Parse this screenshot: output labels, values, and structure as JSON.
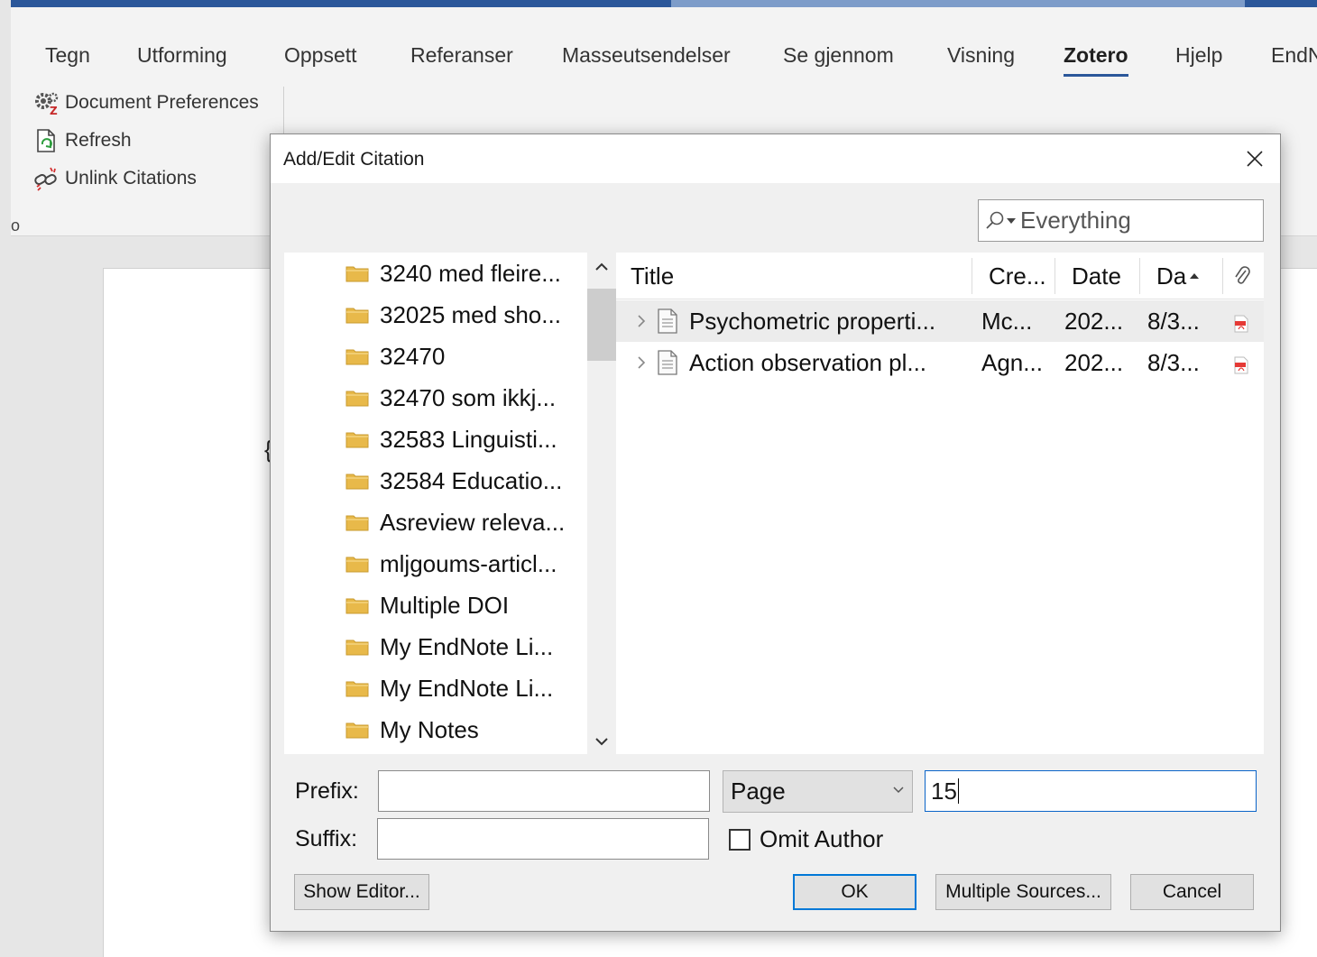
{
  "ribbon": {
    "tabs": [
      {
        "label": "Tegn"
      },
      {
        "label": "Utforming"
      },
      {
        "label": "Oppsett"
      },
      {
        "label": "Referanser"
      },
      {
        "label": "Masseutsendelser"
      },
      {
        "label": "Se gjennom"
      },
      {
        "label": "Visning"
      },
      {
        "label": "Zotero",
        "active": true
      },
      {
        "label": "Hjelp"
      },
      {
        "label": "EndN"
      }
    ],
    "commands": {
      "document_preferences": "Document Preferences",
      "refresh": "Refresh",
      "unlink_citations": "Unlink Citations"
    },
    "group_label": "o"
  },
  "document": {
    "visible_text": "{"
  },
  "dialog": {
    "title": "Add/Edit Citation",
    "search": {
      "mode_value": "Everything"
    },
    "collections": [
      "3240 med fleire...",
      "32025 med sho...",
      "32470",
      "32470 som ikkj...",
      "32583 Linguisti...",
      "32584 Educatio...",
      "Asreview releva...",
      "mljgoums-articl...",
      "Multiple DOI",
      "My EndNote Li...",
      "My EndNote Li...",
      "My Notes"
    ],
    "items_columns": {
      "title": "Title",
      "creator": "Cre...",
      "date": "Date",
      "date_added": "Da"
    },
    "items": [
      {
        "title": "Psychometric properti...",
        "creator": "Mc...",
        "date": "202...",
        "date_added": "8/3..."
      },
      {
        "title": "Action observation pl...",
        "creator": "Agn...",
        "date": "202...",
        "date_added": "8/3..."
      }
    ],
    "form": {
      "prefix_label": "Prefix:",
      "prefix_value": "",
      "suffix_label": "Suffix:",
      "suffix_value": "",
      "locator_type": "Page",
      "locator_value": "15",
      "omit_author_label": "Omit Author",
      "omit_author_checked": false
    },
    "buttons": {
      "show_editor": "Show Editor...",
      "ok": "OK",
      "multiple_sources": "Multiple Sources...",
      "cancel": "Cancel"
    }
  },
  "colors": {
    "word_blue": "#2b579a",
    "focus_blue": "#0078d7",
    "folder_yellow": "#e8b94a",
    "selected_row": "#ececec"
  }
}
